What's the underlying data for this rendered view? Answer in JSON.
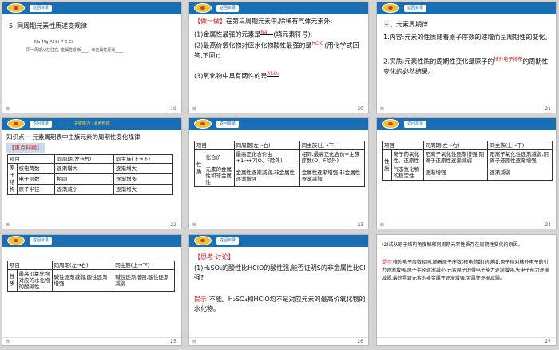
{
  "header": {
    "back_button": "返回目录",
    "hint_s22": "关键能力 · 素养形成"
  },
  "s19": {
    "title": "5. 同周期元素性质递变规律",
    "elements": "Na  Mg  Al  Si  P  S  Cl",
    "line": "同一周期从左往右, 金属性逐渐____, 非金属性逐渐____",
    "page": "19"
  },
  "s20": {
    "label": "【做一做】",
    "intro": "在第三周期元素中,除稀有气体元素外:",
    "q1": "(1)金属性最强的元素是",
    "q1_ans": "Na",
    "q1_tail": "(填元素符号);",
    "q2": "(2)最高价氧化物对应水化物酸性最强的是",
    "q2_ans": "HClO",
    "q2_tail": "(用化学式回答,下同);",
    "q3": "(3)氧化物中具有两性的是",
    "q3_ans": "Al₂O₃",
    "page": "20"
  },
  "s21": {
    "h": "三、元素周期律",
    "l1": "1.内容:元素的性质随着原子序数的递增而呈周期性的变化。",
    "l2a": "2.实质:元素性质的周期性变化是原子的",
    "l2_ans": "核外电子排布",
    "l2b": "的周期性变化的必然结果。",
    "page": "21"
  },
  "s22": {
    "heading": "知识点一 元素周期表中主族元素的周期性变化规律",
    "tag": "【重点释疑】",
    "table": {
      "head": [
        "项目",
        "同周期(左→右)",
        "同主族(上→下)"
      ],
      "group": "原子结构",
      "rows": [
        [
          "核电荷数",
          "逐渐增大",
          "逐渐增大"
        ],
        [
          "电子层数",
          "相同",
          "逐渐增多"
        ],
        [
          "原子半径",
          "逐渐减小",
          "逐渐增大"
        ]
      ]
    },
    "page": "22"
  },
  "s23": {
    "head": [
      "项目",
      "同周期(左→右)",
      "同主族(上→下)"
    ],
    "group": "性质",
    "rows": [
      [
        "化合价",
        "最高正化合价由+1→+7(O、F除外)",
        "相同,最高正化合价=主族序数(O、F除外)"
      ],
      [
        "元素的金属性和非金属性",
        "金属性逐渐减弱,非金属性逐渐增强",
        "金属性逐渐增强,非金属性逐渐减弱"
      ]
    ],
    "page": "23"
  },
  "s24": {
    "head": [
      "项目",
      "同周期(左→右)",
      "同主族(上→下)"
    ],
    "group": "性质",
    "rows": [
      [
        "离子的氧化性、还原性",
        "阳离子氧化性逐渐增强,阴离子还原性逐渐减弱",
        "阳离子氧化性逐渐减弱,阴离子还原性逐渐增强"
      ],
      [
        "气态氢化物的稳定性",
        "逐渐增强",
        "逐渐减弱"
      ]
    ],
    "page": "24"
  },
  "s25": {
    "head": [
      "项目",
      "同周期(左→右)",
      "同主族(上→下)"
    ],
    "group": "性质",
    "rows": [
      [
        "最高价氧化物对应的水化物的酸碱性",
        "碱性逐渐减弱,酸性逐渐增强",
        "碱性逐渐增强,酸性逐渐减弱"
      ]
    ],
    "page": "25"
  },
  "s26": {
    "label": "【思考·讨论】",
    "q": "(1)H₂SO₄的酸性比HClO的酸性强,能否证明S的非金属性比Cl强?",
    "hint_label": "提示:",
    "hint": "不能。H₂SO₄和HClO均不是对应元素的最高价氧化物的水化物。",
    "page": "26"
  },
  "s27": {
    "q": "(2)试从原子结构角度解释同周期元素性质存在周期性变化的原因。",
    "hint_label": "提示:",
    "hint": "核外电子层数相同,随着原子序数(核电荷数)的递增,原子核对核外电子的引力逐渐增强,原子半径逐渐减小,元素原子的得电子能力逐渐增强,失电子能力逐渐减弱,最终导致元素的非金属性逐渐增强,金属性逐渐减弱。",
    "page": "27"
  },
  "footer": {
    "left": "微"
  }
}
